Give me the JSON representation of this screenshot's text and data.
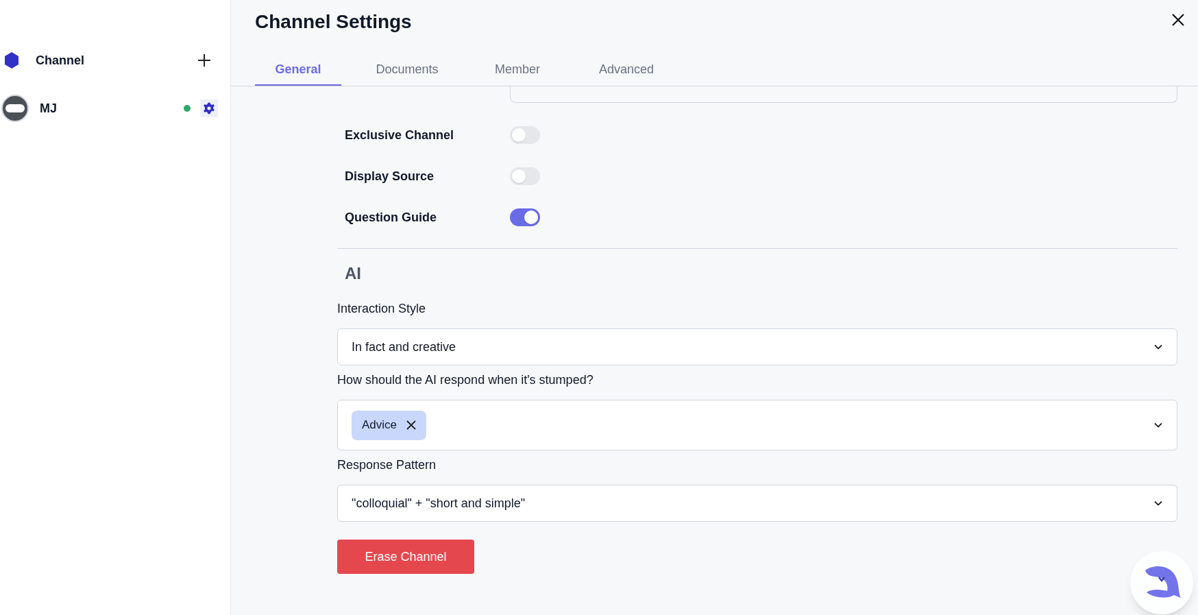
{
  "sidebar": {
    "header": {
      "label": "Channel"
    },
    "items": [
      {
        "name": "MJ",
        "online": true
      }
    ]
  },
  "dialog": {
    "title": "Channel Settings",
    "tabs": [
      {
        "label": "General",
        "selected": true
      },
      {
        "label": "Documents",
        "selected": false
      },
      {
        "label": "Member",
        "selected": false
      },
      {
        "label": "Advanced",
        "selected": false
      }
    ],
    "toggles": [
      {
        "label": "Exclusive Channel",
        "on": false
      },
      {
        "label": "Display Source",
        "on": false
      },
      {
        "label": "Question Guide",
        "on": true
      }
    ],
    "section": "AI",
    "fields": [
      {
        "kind": "select",
        "label": "Interaction Style",
        "value": "In fact and creative"
      },
      {
        "kind": "multiselect",
        "label": "How should the AI respond when it's stumped?",
        "tags": [
          "Advice"
        ]
      },
      {
        "kind": "select",
        "label": "Response Pattern",
        "value": "\"colloquial\" + \"short and simple\""
      }
    ],
    "danger_button": "Erase Channel"
  }
}
